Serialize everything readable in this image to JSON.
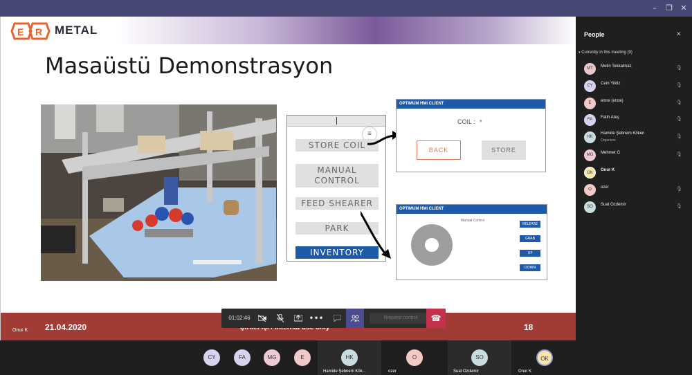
{
  "window": {
    "controls": [
      "minimize-icon",
      "restore-icon",
      "close-icon"
    ]
  },
  "slide": {
    "logo_text": "METAL",
    "logo_mark": "ER",
    "title": "Masaüstü Demonstrasyon",
    "hmi_main": {
      "buttons": [
        {
          "label": "STORE COIL"
        },
        {
          "label": "MANUAL CONTROL"
        },
        {
          "label": "FEED SHEARER"
        },
        {
          "label": "PARK"
        },
        {
          "label": "INVENTORY"
        }
      ],
      "menu_icon": "menu-icon"
    },
    "hmi_win1": {
      "title": "OPTIMUM HMI CLIENT",
      "coil_label": "COIL :",
      "back_label": "BACK",
      "store_label": "STORE"
    },
    "hmi_win2": {
      "title": "OPTIMUM HMI CLIENT",
      "subtitle": "Manual Control",
      "buttons": [
        "RELEASE",
        "GRAB",
        "UP",
        "DOWN"
      ]
    },
    "footer": {
      "date": "21.04.2020",
      "page": "18",
      "classification": "Şirket İçi / Internal use only"
    },
    "presenter_label": "Onur K"
  },
  "call_controls": {
    "timer": "01:02:46",
    "request_control": "Request control",
    "icons": [
      "video-off-icon",
      "mic-off-icon",
      "share-icon",
      "more-icon",
      "chat-icon",
      "participants-icon",
      "hangup-icon"
    ]
  },
  "people_panel": {
    "title": "People",
    "section_label": "Currently in this meeting (9)",
    "participants": [
      {
        "initials": "MT",
        "name": "Metin Tekkalmaz",
        "role": "",
        "color": "#e8c9c9",
        "muted": true
      },
      {
        "initials": "CY",
        "name": "Cem Yildiz",
        "role": "",
        "color": "#d5d3ee",
        "muted": true
      },
      {
        "initials": "E",
        "name": "emre (erste)",
        "role": "",
        "color": "#f2c9c9",
        "muted": true
      },
      {
        "initials": "FA",
        "name": "Fatih Ateş",
        "role": "",
        "color": "#d5d3ee",
        "muted": true
      },
      {
        "initials": "HK",
        "name": "Hamide Şebnem Köken",
        "role": "Organizer",
        "color": "#c9dce0",
        "muted": true
      },
      {
        "initials": "MG",
        "name": "Mehmet G",
        "role": "",
        "color": "#efc9d4",
        "muted": true
      },
      {
        "initials": "OK",
        "name": "Onur K",
        "role": "",
        "color": "#f6e6a8",
        "muted": false
      },
      {
        "initials": "O",
        "name": "ozer",
        "role": "",
        "color": "#f4c9c4",
        "muted": true
      },
      {
        "initials": "SO",
        "name": "Suat Ozdemir",
        "role": "",
        "color": "#c9dce0",
        "muted": true
      }
    ]
  },
  "gallery": {
    "avatars": [
      {
        "initials": "CY",
        "color": "#d5d3ee"
      },
      {
        "initials": "FA",
        "color": "#d5d3ee"
      },
      {
        "initials": "MG",
        "color": "#efc9d4"
      },
      {
        "initials": "E",
        "color": "#f2c9c9"
      }
    ],
    "tiles": [
      {
        "initials": "HK",
        "name": "Hamide Şebnem Kök...",
        "color": "#c9dce0"
      },
      {
        "initials": "O",
        "name": "ozer",
        "color": "#f4c9c4"
      },
      {
        "initials": "SO",
        "name": "Suat Ozdemir",
        "color": "#c9dce0"
      },
      {
        "initials": "OK",
        "name": "Onur K",
        "color": "#f6e6a8"
      }
    ]
  }
}
